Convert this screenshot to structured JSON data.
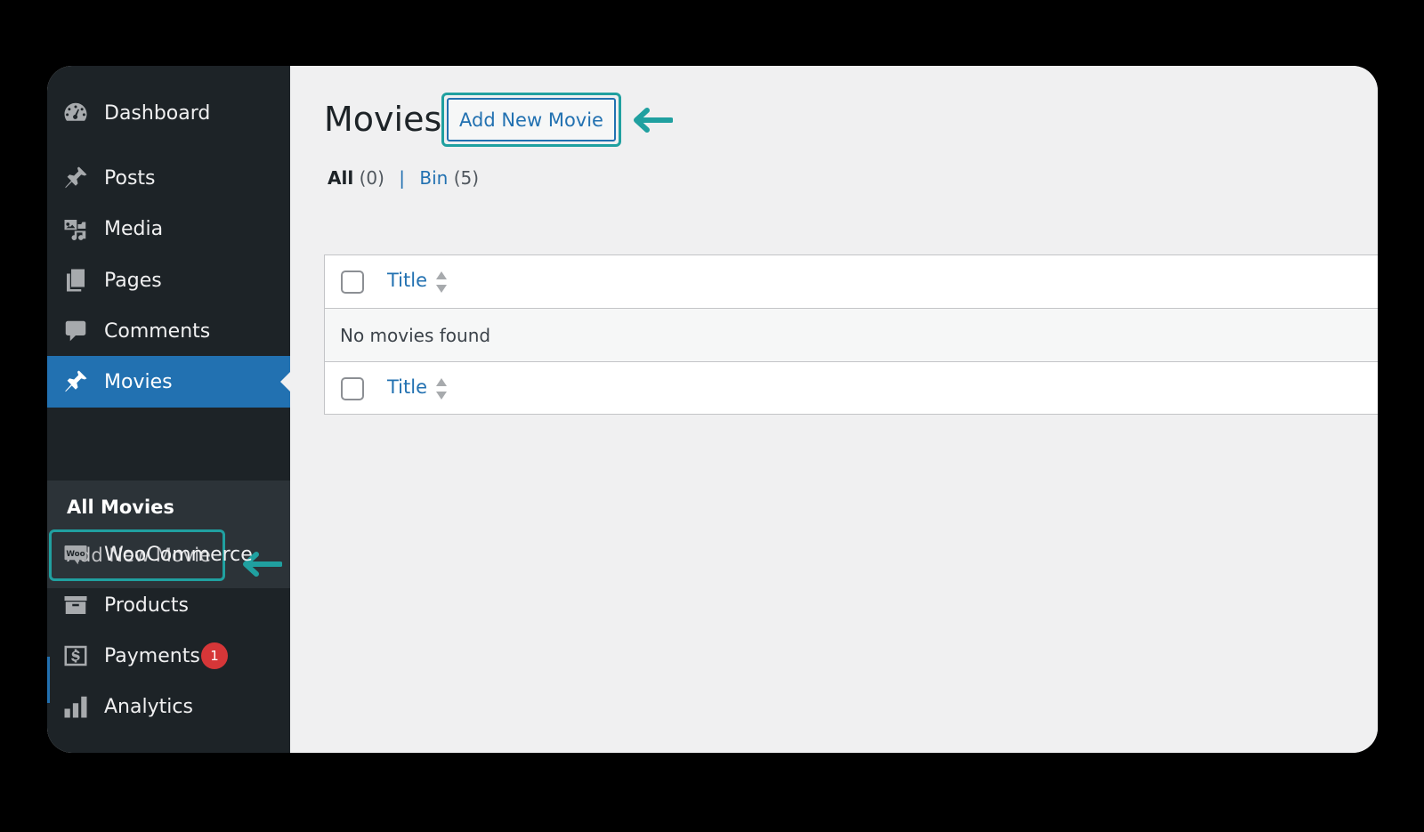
{
  "sidebar": {
    "items": [
      {
        "label": "Dashboard",
        "icon": "dashboard-icon"
      },
      {
        "label": "Posts",
        "icon": "pushpin-icon"
      },
      {
        "label": "Media",
        "icon": "media-icon"
      },
      {
        "label": "Pages",
        "icon": "pages-icon"
      },
      {
        "label": "Comments",
        "icon": "comment-icon"
      },
      {
        "label": "Movies",
        "icon": "pushpin-icon"
      },
      {
        "label": "WooCommerce",
        "icon": "woo-icon"
      },
      {
        "label": "Products",
        "icon": "archive-icon"
      },
      {
        "label": "Payments",
        "icon": "dollar-icon",
        "badge": "1"
      },
      {
        "label": "Analytics",
        "icon": "bar-chart-icon"
      }
    ],
    "submenu": {
      "current": "All Movies",
      "add_new": "Add New Movie"
    }
  },
  "main": {
    "title": "Movies",
    "add_new_button": "Add New Movie",
    "filters": {
      "all_label": "All",
      "all_count": "(0)",
      "separator": "|",
      "bin_label": "Bin",
      "bin_count": "(5)"
    },
    "table": {
      "header_title": "Title",
      "empty_message": "No movies found",
      "footer_title": "Title"
    }
  },
  "colors": {
    "sidebar_bg": "#1d2327",
    "active_menu": "#2271b1",
    "highlight": "#20a0a0",
    "badge": "#d63638"
  }
}
